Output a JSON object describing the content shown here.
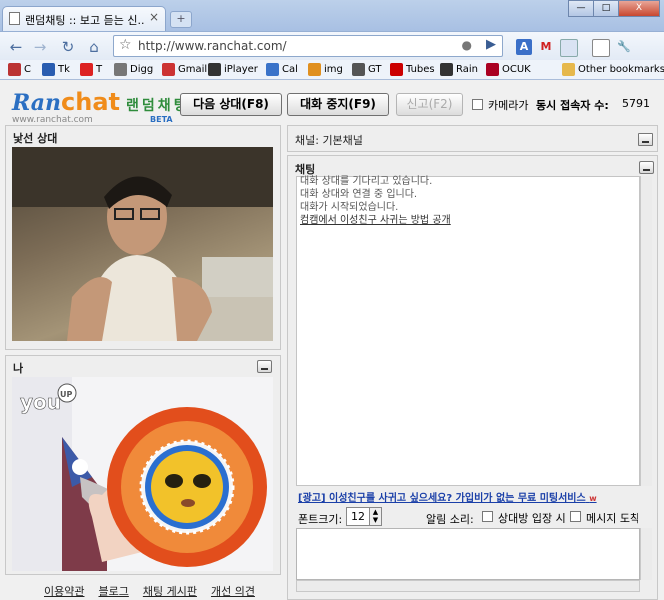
{
  "browser": {
    "tab_title": "랜덤채팅 :: 보고 듣는 신...",
    "tab_close": "×",
    "new_tab": "+",
    "url": "http://www.ranchat.com/",
    "window": {
      "minimize": "—",
      "maximize": "□",
      "close": "X"
    }
  },
  "bookmarks": [
    {
      "label": "C",
      "icon": "c-icon",
      "color": "#b33"
    },
    {
      "label": "Tk",
      "icon": "tk-icon",
      "color": "#2a5db0"
    },
    {
      "label": "T",
      "icon": "t-icon",
      "color": "#d22"
    },
    {
      "label": "Digg",
      "icon": "digg-icon",
      "color": "#777"
    },
    {
      "label": "Gmail",
      "icon": "gmail-icon",
      "color": "#c33"
    },
    {
      "label": "iPlayer",
      "icon": "bbc-icon",
      "color": "#333"
    },
    {
      "label": "Cal",
      "icon": "calendar-icon",
      "color": "#3a73c9"
    },
    {
      "label": "img",
      "icon": "img-icon",
      "color": "#e09020"
    },
    {
      "label": "GT",
      "icon": "gt-icon",
      "color": "#555"
    },
    {
      "label": "Tubes",
      "icon": "youtube-icon",
      "color": "#c00"
    },
    {
      "label": "Rain",
      "icon": "bbc-icon",
      "color": "#333"
    },
    {
      "label": "OCUK",
      "icon": "ocuk-icon",
      "color": "#a02"
    },
    {
      "label": "Other bookmarks",
      "icon": "folder-icon",
      "color": "#e6b84c"
    }
  ],
  "site": {
    "logo_ran": "Ran",
    "logo_chat": "chat",
    "logo_kr": "랜덤채팅",
    "logo_url": "www.ranchat.com",
    "logo_beta": "BETA",
    "btn_next": "다음 상대(F8)",
    "btn_stop": "대화 중지(F9)",
    "btn_report": "신고(F2)",
    "camera_label": "카메라가",
    "concurrent_label": "동시 접속자 수:",
    "concurrent_value": "5791",
    "stranger_title": "낯선 상대",
    "me_title": "나",
    "channel_label": "채널: 기본채널",
    "chat_title": "채팅",
    "chat_lines": [
      "대화 상대를 기다리고 있습니다.",
      "대화 상대와 연결 중 입니다.",
      "대화가 시작되었습니다."
    ],
    "chat_link": "컴캠에서 이성친구 사귀는 방법 공개",
    "ad_text": "[광고] 이성친구를 사귀고 싶으세요? 가입비가 없는 무료 미팅서비스",
    "ad_suffix": "w",
    "font_size_label": "폰트크기:",
    "font_size_value": "12",
    "alert_sound_label": "알림 소리:",
    "alert_opt1": "상대방 입장 시",
    "alert_opt2": "메시지 도착",
    "youup_text": "you",
    "youup_badge": "UP",
    "footer": [
      "이용약관",
      "블로그",
      "채팅 게시판",
      "개선 의견"
    ]
  }
}
